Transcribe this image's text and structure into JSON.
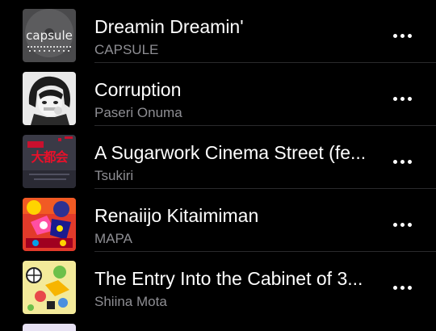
{
  "tracks": [
    {
      "title": "Dreamin Dreamin'",
      "artist": "CAPSULE",
      "art_icon": "capsule-album-art",
      "art_text": "capsule"
    },
    {
      "title": "Corruption",
      "artist": "Paseri Onuma",
      "art_icon": "anime-character-album-art"
    },
    {
      "title": "A Sugarwork Cinema Street (fe...",
      "artist": "Tsukiri",
      "art_icon": "red-poster-album-art",
      "art_text": "大都会"
    },
    {
      "title": "Renaiijo Kitaimiman",
      "artist": "MAPA",
      "art_icon": "colorful-collage-album-art"
    },
    {
      "title": "The Entry Into the Cabinet of 3...",
      "artist": "Shiina Mota",
      "art_icon": "yellow-illustration-album-art"
    }
  ],
  "more_icon": "ellipsis-icon",
  "colors": {
    "background": "#000000",
    "title": "#ffffff",
    "artist": "#8e8e93",
    "divider": "#2a2a2c"
  }
}
